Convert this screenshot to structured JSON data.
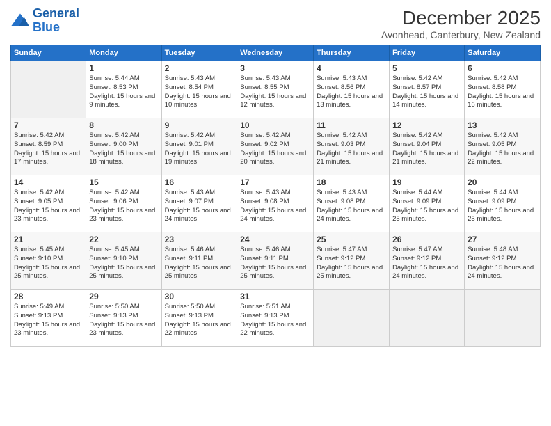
{
  "logo": {
    "line1": "General",
    "line2": "Blue"
  },
  "title": "December 2025",
  "subtitle": "Avonhead, Canterbury, New Zealand",
  "days_of_week": [
    "Sunday",
    "Monday",
    "Tuesday",
    "Wednesday",
    "Thursday",
    "Friday",
    "Saturday"
  ],
  "weeks": [
    [
      {
        "day": "",
        "sunrise": "",
        "sunset": "",
        "daylight": ""
      },
      {
        "day": "1",
        "sunrise": "Sunrise: 5:44 AM",
        "sunset": "Sunset: 8:53 PM",
        "daylight": "Daylight: 15 hours and 9 minutes."
      },
      {
        "day": "2",
        "sunrise": "Sunrise: 5:43 AM",
        "sunset": "Sunset: 8:54 PM",
        "daylight": "Daylight: 15 hours and 10 minutes."
      },
      {
        "day": "3",
        "sunrise": "Sunrise: 5:43 AM",
        "sunset": "Sunset: 8:55 PM",
        "daylight": "Daylight: 15 hours and 12 minutes."
      },
      {
        "day": "4",
        "sunrise": "Sunrise: 5:43 AM",
        "sunset": "Sunset: 8:56 PM",
        "daylight": "Daylight: 15 hours and 13 minutes."
      },
      {
        "day": "5",
        "sunrise": "Sunrise: 5:42 AM",
        "sunset": "Sunset: 8:57 PM",
        "daylight": "Daylight: 15 hours and 14 minutes."
      },
      {
        "day": "6",
        "sunrise": "Sunrise: 5:42 AM",
        "sunset": "Sunset: 8:58 PM",
        "daylight": "Daylight: 15 hours and 16 minutes."
      }
    ],
    [
      {
        "day": "7",
        "sunrise": "Sunrise: 5:42 AM",
        "sunset": "Sunset: 8:59 PM",
        "daylight": "Daylight: 15 hours and 17 minutes."
      },
      {
        "day": "8",
        "sunrise": "Sunrise: 5:42 AM",
        "sunset": "Sunset: 9:00 PM",
        "daylight": "Daylight: 15 hours and 18 minutes."
      },
      {
        "day": "9",
        "sunrise": "Sunrise: 5:42 AM",
        "sunset": "Sunset: 9:01 PM",
        "daylight": "Daylight: 15 hours and 19 minutes."
      },
      {
        "day": "10",
        "sunrise": "Sunrise: 5:42 AM",
        "sunset": "Sunset: 9:02 PM",
        "daylight": "Daylight: 15 hours and 20 minutes."
      },
      {
        "day": "11",
        "sunrise": "Sunrise: 5:42 AM",
        "sunset": "Sunset: 9:03 PM",
        "daylight": "Daylight: 15 hours and 21 minutes."
      },
      {
        "day": "12",
        "sunrise": "Sunrise: 5:42 AM",
        "sunset": "Sunset: 9:04 PM",
        "daylight": "Daylight: 15 hours and 21 minutes."
      },
      {
        "day": "13",
        "sunrise": "Sunrise: 5:42 AM",
        "sunset": "Sunset: 9:05 PM",
        "daylight": "Daylight: 15 hours and 22 minutes."
      }
    ],
    [
      {
        "day": "14",
        "sunrise": "Sunrise: 5:42 AM",
        "sunset": "Sunset: 9:05 PM",
        "daylight": "Daylight: 15 hours and 23 minutes."
      },
      {
        "day": "15",
        "sunrise": "Sunrise: 5:42 AM",
        "sunset": "Sunset: 9:06 PM",
        "daylight": "Daylight: 15 hours and 23 minutes."
      },
      {
        "day": "16",
        "sunrise": "Sunrise: 5:43 AM",
        "sunset": "Sunset: 9:07 PM",
        "daylight": "Daylight: 15 hours and 24 minutes."
      },
      {
        "day": "17",
        "sunrise": "Sunrise: 5:43 AM",
        "sunset": "Sunset: 9:08 PM",
        "daylight": "Daylight: 15 hours and 24 minutes."
      },
      {
        "day": "18",
        "sunrise": "Sunrise: 5:43 AM",
        "sunset": "Sunset: 9:08 PM",
        "daylight": "Daylight: 15 hours and 24 minutes."
      },
      {
        "day": "19",
        "sunrise": "Sunrise: 5:44 AM",
        "sunset": "Sunset: 9:09 PM",
        "daylight": "Daylight: 15 hours and 25 minutes."
      },
      {
        "day": "20",
        "sunrise": "Sunrise: 5:44 AM",
        "sunset": "Sunset: 9:09 PM",
        "daylight": "Daylight: 15 hours and 25 minutes."
      }
    ],
    [
      {
        "day": "21",
        "sunrise": "Sunrise: 5:45 AM",
        "sunset": "Sunset: 9:10 PM",
        "daylight": "Daylight: 15 hours and 25 minutes."
      },
      {
        "day": "22",
        "sunrise": "Sunrise: 5:45 AM",
        "sunset": "Sunset: 9:10 PM",
        "daylight": "Daylight: 15 hours and 25 minutes."
      },
      {
        "day": "23",
        "sunrise": "Sunrise: 5:46 AM",
        "sunset": "Sunset: 9:11 PM",
        "daylight": "Daylight: 15 hours and 25 minutes."
      },
      {
        "day": "24",
        "sunrise": "Sunrise: 5:46 AM",
        "sunset": "Sunset: 9:11 PM",
        "daylight": "Daylight: 15 hours and 25 minutes."
      },
      {
        "day": "25",
        "sunrise": "Sunrise: 5:47 AM",
        "sunset": "Sunset: 9:12 PM",
        "daylight": "Daylight: 15 hours and 25 minutes."
      },
      {
        "day": "26",
        "sunrise": "Sunrise: 5:47 AM",
        "sunset": "Sunset: 9:12 PM",
        "daylight": "Daylight: 15 hours and 24 minutes."
      },
      {
        "day": "27",
        "sunrise": "Sunrise: 5:48 AM",
        "sunset": "Sunset: 9:12 PM",
        "daylight": "Daylight: 15 hours and 24 minutes."
      }
    ],
    [
      {
        "day": "28",
        "sunrise": "Sunrise: 5:49 AM",
        "sunset": "Sunset: 9:13 PM",
        "daylight": "Daylight: 15 hours and 23 minutes."
      },
      {
        "day": "29",
        "sunrise": "Sunrise: 5:50 AM",
        "sunset": "Sunset: 9:13 PM",
        "daylight": "Daylight: 15 hours and 23 minutes."
      },
      {
        "day": "30",
        "sunrise": "Sunrise: 5:50 AM",
        "sunset": "Sunset: 9:13 PM",
        "daylight": "Daylight: 15 hours and 22 minutes."
      },
      {
        "day": "31",
        "sunrise": "Sunrise: 5:51 AM",
        "sunset": "Sunset: 9:13 PM",
        "daylight": "Daylight: 15 hours and 22 minutes."
      },
      {
        "day": "",
        "sunrise": "",
        "sunset": "",
        "daylight": ""
      },
      {
        "day": "",
        "sunrise": "",
        "sunset": "",
        "daylight": ""
      },
      {
        "day": "",
        "sunrise": "",
        "sunset": "",
        "daylight": ""
      }
    ]
  ]
}
